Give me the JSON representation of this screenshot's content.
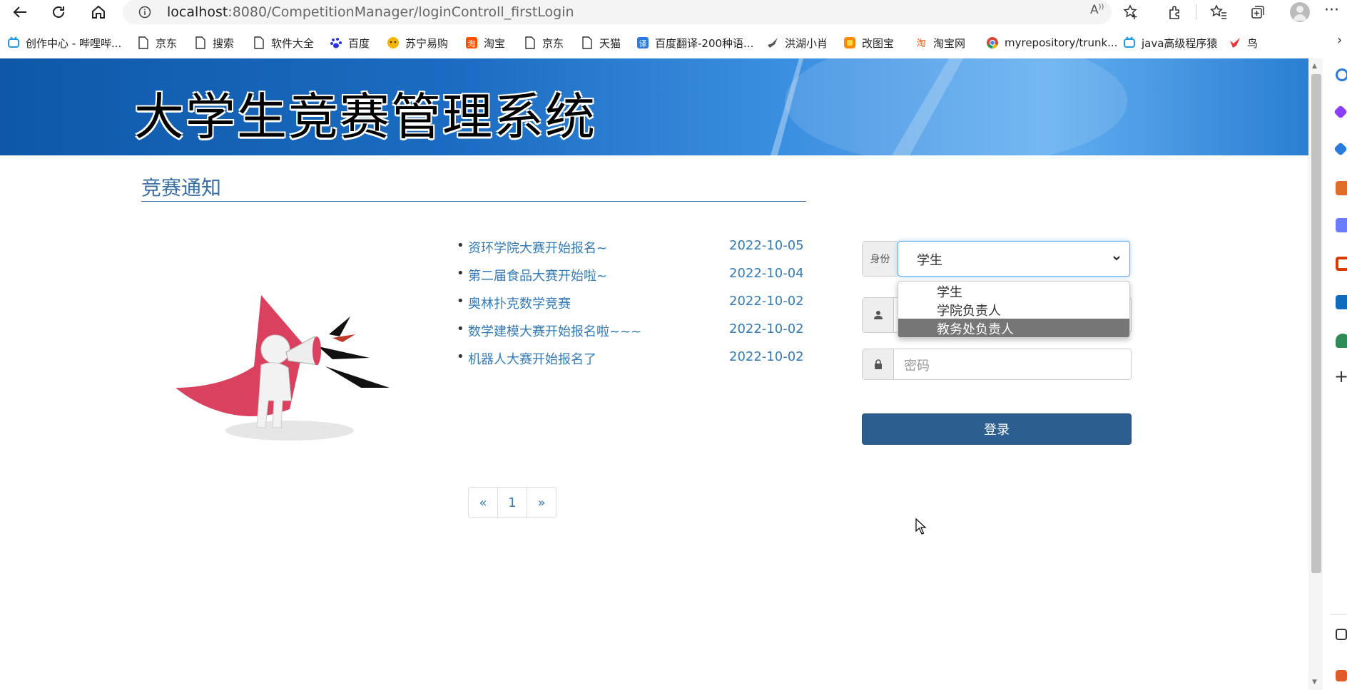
{
  "browser": {
    "url_host": "localhost",
    "url_rest": ":8080/CompetitionManager/loginControll_firstLogin"
  },
  "bookmarks": [
    {
      "label": "创作中心 - 哔哩哔...",
      "icon": "bilibili-icon"
    },
    {
      "label": "京东",
      "icon": "page-icon"
    },
    {
      "label": "搜索",
      "icon": "page-icon"
    },
    {
      "label": "软件大全",
      "icon": "page-icon"
    },
    {
      "label": "百度",
      "icon": "baidu-icon"
    },
    {
      "label": "苏宁易购",
      "icon": "suning-icon"
    },
    {
      "label": "淘宝",
      "icon": "taobao-icon"
    },
    {
      "label": "京东",
      "icon": "page-icon"
    },
    {
      "label": "天猫",
      "icon": "page-icon"
    },
    {
      "label": "百度翻译-200种语...",
      "icon": "translate-icon"
    },
    {
      "label": "洪湖小肖",
      "icon": "bird-icon"
    },
    {
      "label": "改图宝",
      "icon": "gaitubao-icon"
    },
    {
      "label": "淘宝网",
      "icon": "taobao-icon"
    },
    {
      "label": "myrepository/trunk...",
      "icon": "chrome-icon"
    },
    {
      "label": "java高级程序猿",
      "icon": "bilibili-icon"
    },
    {
      "label": "鸟",
      "icon": "bird-icon"
    }
  ],
  "header": {
    "title": "大学生竞赛管理系统"
  },
  "section": {
    "title": "竞赛通知"
  },
  "notices": [
    {
      "title": "资环学院大赛开始报名~",
      "date": "2022-10-05"
    },
    {
      "title": "第二届食品大赛开始啦~",
      "date": "2022-10-04"
    },
    {
      "title": "奥林扑克数学竞赛",
      "date": "2022-10-02"
    },
    {
      "title": "数学建模大赛开始报名啦~~~",
      "date": "2022-10-02"
    },
    {
      "title": "机器人大赛开始报名了",
      "date": "2022-10-02"
    }
  ],
  "login": {
    "role_label": "身份",
    "role_value": "学生",
    "role_options": [
      "学生",
      "学院负责人",
      "教务处负责人"
    ],
    "role_highlighted": "教务处负责人",
    "password_placeholder": "密码",
    "submit_label": "登录"
  },
  "pagination": {
    "prev": "«",
    "current": "1",
    "next": "»"
  }
}
